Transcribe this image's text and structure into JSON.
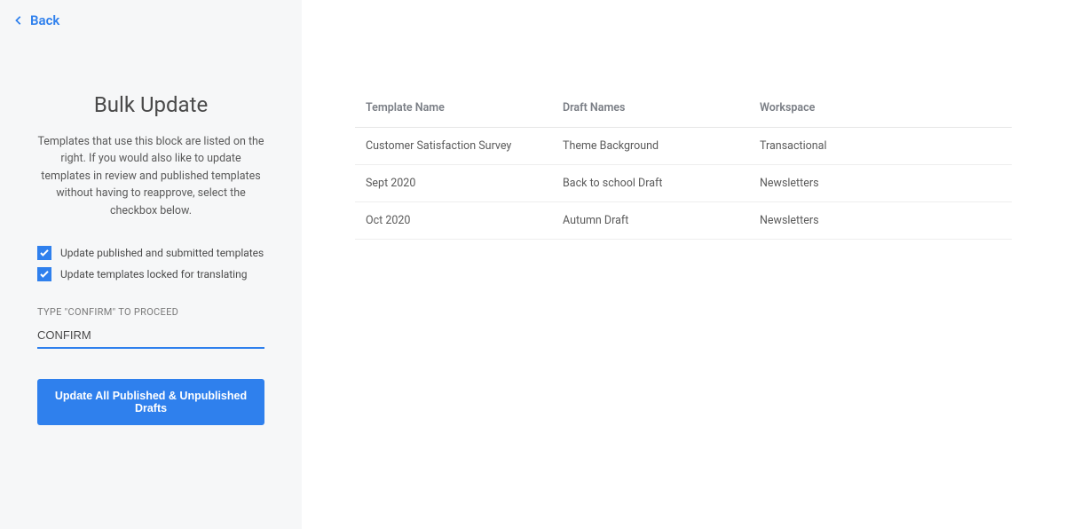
{
  "nav": {
    "back_label": "Back"
  },
  "sidebar": {
    "title": "Bulk Update",
    "description": "Templates that use this block are listed on the right. If you would also like to update templates in review and published templates without having to reapprove, select the checkbox below.",
    "checkbox_published_label": "Update published and submitted templates",
    "checkbox_locked_label": "Update templates locked for translating",
    "confirm_label": "TYPE \"CONFIRM\" TO PROCEED",
    "confirm_value": "CONFIRM",
    "button_label": "Update All Published & Unpublished Drafts"
  },
  "table": {
    "headers": {
      "template": "Template Name",
      "drafts": "Draft Names",
      "workspace": "Workspace"
    },
    "rows": [
      {
        "template": "Customer Satisfaction Survey",
        "drafts": "Theme Background",
        "workspace": "Transactional"
      },
      {
        "template": "Sept 2020",
        "drafts": "Back to school Draft",
        "workspace": "Newsletters"
      },
      {
        "template": "Oct 2020",
        "drafts": "Autumn Draft",
        "workspace": "Newsletters"
      }
    ]
  }
}
